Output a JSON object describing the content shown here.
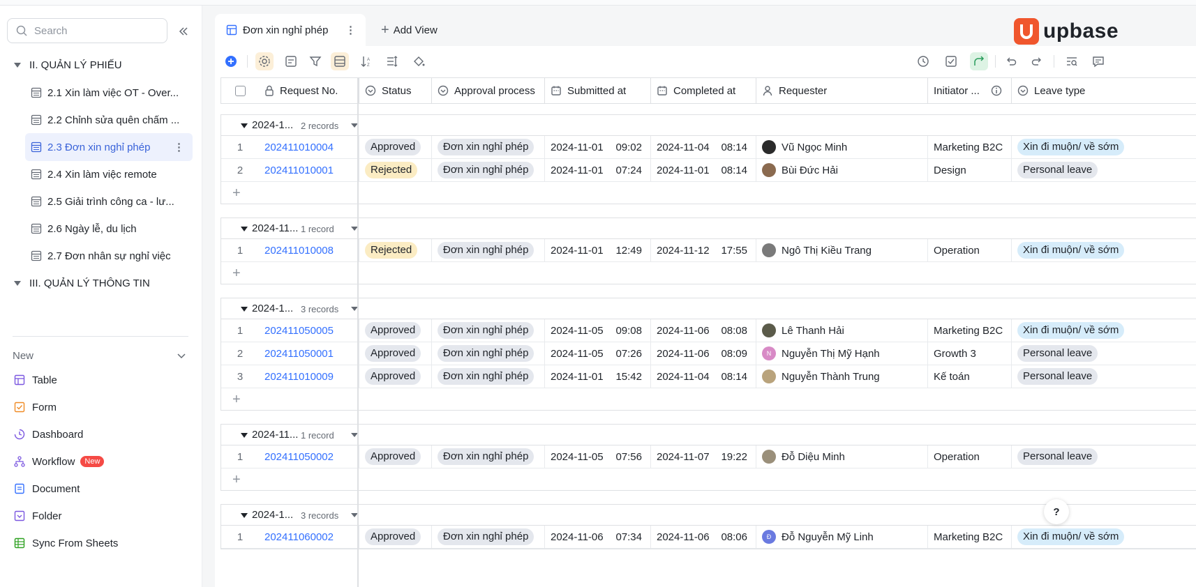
{
  "sidebar": {
    "search_placeholder": "Search",
    "section2": "II. QUẢN LÝ PHIẾU",
    "items": [
      {
        "label": "2.1 Xin làm việc OT - Over..."
      },
      {
        "label": "2.2 Chỉnh sửa quên chấm ..."
      },
      {
        "label": "2.3 Đơn xin nghỉ phép"
      },
      {
        "label": "2.4 Xin làm việc remote"
      },
      {
        "label": "2.5 Giải trình công ca - lư..."
      },
      {
        "label": "2.6 Ngày lễ, du lịch"
      },
      {
        "label": "2.7 Đơn nhân sự nghỉ việc"
      }
    ],
    "section3": "III. QUẢN LÝ THÔNG TIN",
    "new_label": "New",
    "new_items": [
      {
        "label": "Table",
        "icon": "table-icon",
        "color": "#7b57e0"
      },
      {
        "label": "Form",
        "icon": "form-icon",
        "color": "#f08a24"
      },
      {
        "label": "Dashboard",
        "icon": "dashboard-icon",
        "color": "#7b57e0"
      },
      {
        "label": "Workflow",
        "icon": "workflow-icon",
        "color": "#7b57e0",
        "badge": "New"
      },
      {
        "label": "Document",
        "icon": "document-icon",
        "color": "#3370ff"
      },
      {
        "label": "Folder",
        "icon": "folder-icon",
        "color": "#7b57e0"
      },
      {
        "label": "Sync From Sheets",
        "icon": "sheets-icon",
        "color": "#2ea121"
      }
    ]
  },
  "tabs": {
    "active": "Đơn xin nghỉ phép",
    "add_view": "Add View"
  },
  "brand": {
    "name": "upbase",
    "color": "#f0562d"
  },
  "columns": {
    "request_no": "Request No.",
    "status": "Status",
    "approval": "Approval process",
    "submitted": "Submitted at",
    "completed": "Completed at",
    "requester": "Requester",
    "initiator": "Initiator ...",
    "leave_type": "Leave type"
  },
  "groups": [
    {
      "title": "2024-1...",
      "count": "2 records",
      "rows": [
        {
          "idx": "1",
          "req": "202411010004",
          "status": "Approved",
          "flow": "Đơn xin nghỉ phép",
          "sub_d": "2024-11-01",
          "sub_t": "09:02",
          "comp_d": "2024-11-04",
          "comp_t": "08:14",
          "requester": "Vũ Ngọc Minh",
          "initiator": "Marketing B2C",
          "leave": "Xin đi muộn/ về sớm"
        },
        {
          "idx": "2",
          "req": "202411010001",
          "status": "Rejected",
          "flow": "Đơn xin nghỉ phép",
          "sub_d": "2024-11-01",
          "sub_t": "07:24",
          "comp_d": "2024-11-01",
          "comp_t": "08:14",
          "requester": "Bùi Đức Hải",
          "initiator": "Design",
          "leave": "Personal leave"
        }
      ]
    },
    {
      "title": "2024-11...",
      "count": "1 record",
      "rows": [
        {
          "idx": "1",
          "req": "202411010008",
          "status": "Rejected",
          "flow": "Đơn xin nghỉ phép",
          "sub_d": "2024-11-01",
          "sub_t": "12:49",
          "comp_d": "2024-11-12",
          "comp_t": "17:55",
          "requester": "Ngô Thị Kiều Trang",
          "initiator": "Operation",
          "leave": "Xin đi muộn/ về sớm"
        }
      ]
    },
    {
      "title": "2024-1...",
      "count": "3 records",
      "rows": [
        {
          "idx": "1",
          "req": "202411050005",
          "status": "Approved",
          "flow": "Đơn xin nghỉ phép",
          "sub_d": "2024-11-05",
          "sub_t": "09:08",
          "comp_d": "2024-11-06",
          "comp_t": "08:08",
          "requester": "Lê Thanh Hải",
          "initiator": "Marketing B2C",
          "leave": "Xin đi muộn/ về sớm"
        },
        {
          "idx": "2",
          "req": "202411050001",
          "status": "Approved",
          "flow": "Đơn xin nghỉ phép",
          "sub_d": "2024-11-05",
          "sub_t": "07:26",
          "comp_d": "2024-11-06",
          "comp_t": "08:09",
          "requester": "Nguyễn Thị Mỹ Hạnh",
          "initiator": "Growth 3",
          "leave": "Personal leave"
        },
        {
          "idx": "3",
          "req": "202411010009",
          "status": "Approved",
          "flow": "Đơn xin nghỉ phép",
          "sub_d": "2024-11-01",
          "sub_t": "15:42",
          "comp_d": "2024-11-04",
          "comp_t": "08:14",
          "requester": "Nguyễn Thành Trung",
          "initiator": "Kế toán",
          "leave": "Personal leave"
        }
      ]
    },
    {
      "title": "2024-11...",
      "count": "1 record",
      "rows": [
        {
          "idx": "1",
          "req": "202411050002",
          "status": "Approved",
          "flow": "Đơn xin nghỉ phép",
          "sub_d": "2024-11-05",
          "sub_t": "07:56",
          "comp_d": "2024-11-07",
          "comp_t": "19:22",
          "requester": "Đỗ Diệu Minh",
          "initiator": "Operation",
          "leave": "Personal leave"
        }
      ]
    },
    {
      "title": "2024-1...",
      "count": "3 records",
      "rows": [
        {
          "idx": "1",
          "req": "202411060002",
          "status": "Approved",
          "flow": "Đơn xin nghỉ phép",
          "sub_d": "2024-11-06",
          "sub_t": "07:34",
          "comp_d": "2024-11-06",
          "comp_t": "08:06",
          "requester": "Đỗ Nguyễn Mỹ Linh",
          "initiator": "Marketing B2C",
          "leave": "Xin đi muộn/ về sớm"
        }
      ]
    }
  ],
  "avatars": {
    "n_initial": "N",
    "d_initial": "Đ"
  },
  "help": "?"
}
